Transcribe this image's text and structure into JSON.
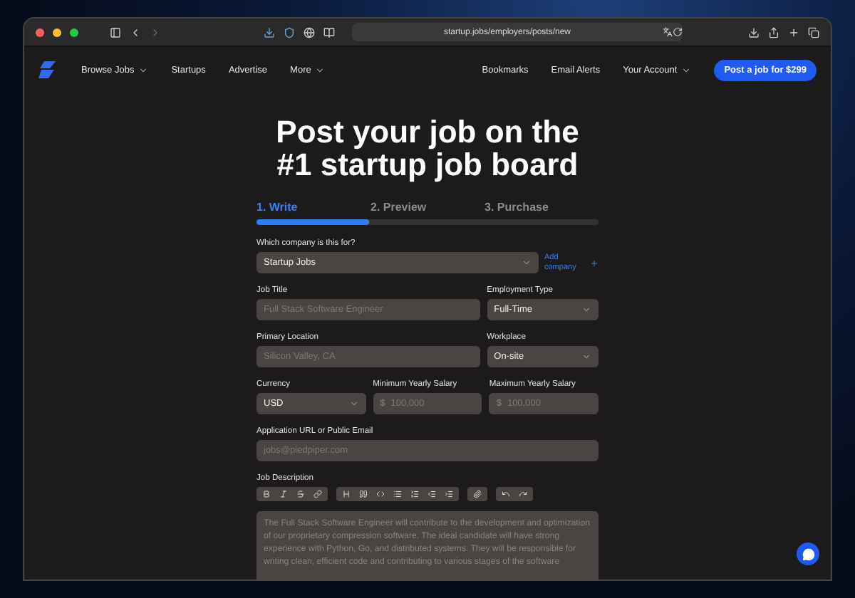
{
  "browser": {
    "url": "startup.jobs/employers/posts/new"
  },
  "nav": {
    "left": [
      {
        "label": "Browse Jobs",
        "dropdown": true
      },
      {
        "label": "Startups",
        "dropdown": false
      },
      {
        "label": "Advertise",
        "dropdown": false
      },
      {
        "label": "More",
        "dropdown": true
      }
    ],
    "right": [
      {
        "label": "Bookmarks",
        "dropdown": false
      },
      {
        "label": "Email Alerts",
        "dropdown": false
      },
      {
        "label": "Your Account",
        "dropdown": true
      }
    ],
    "cta": "Post a job for $299"
  },
  "title_lines": [
    "Post your job on the",
    "#1 startup job board"
  ],
  "steps": [
    {
      "label": "1. Write",
      "selected": true
    },
    {
      "label": "2. Preview",
      "selected": false
    },
    {
      "label": "3. Purchase",
      "selected": false
    }
  ],
  "progress": {
    "level": 0.33
  },
  "rows": [
    [
      {
        "kind": "select",
        "label": "Which company is this for?",
        "value": "Startup Jobs",
        "link": "Add company"
      }
    ],
    [
      {
        "kind": "input",
        "label": "Job Title",
        "placeholder": "Full Stack Software Engineer"
      },
      {
        "kind": "select",
        "label": "Employment Type",
        "value": "Full-Time"
      }
    ],
    [
      {
        "kind": "input",
        "label": "Primary Location",
        "placeholder": "Silicon Valley, CA"
      },
      {
        "kind": "select",
        "label": "Workplace",
        "value": "On-site"
      }
    ],
    [
      {
        "kind": "select",
        "label": "Currency",
        "value": "USD"
      },
      {
        "kind": "money",
        "label": "Minimum Yearly Salary",
        "prefix": "$",
        "placeholder": "100,000"
      },
      {
        "kind": "money",
        "label": "Maximum Yearly Salary",
        "prefix": "$",
        "placeholder": "100,000"
      }
    ],
    [
      {
        "kind": "input",
        "label": "Application URL or Public Email",
        "placeholder": "jobs@piedpiper.com"
      }
    ],
    [
      {
        "kind": "editor",
        "label": "Job Description",
        "placeholder": "The Full Stack Software Engineer will contribute to the development and optimization of our proprietary compression software. The ideal candidate will have strong experience with Python, Go, and distributed systems. They will be responsible for writing clean, efficient code and contributing to various stages of the software"
      }
    ]
  ]
}
